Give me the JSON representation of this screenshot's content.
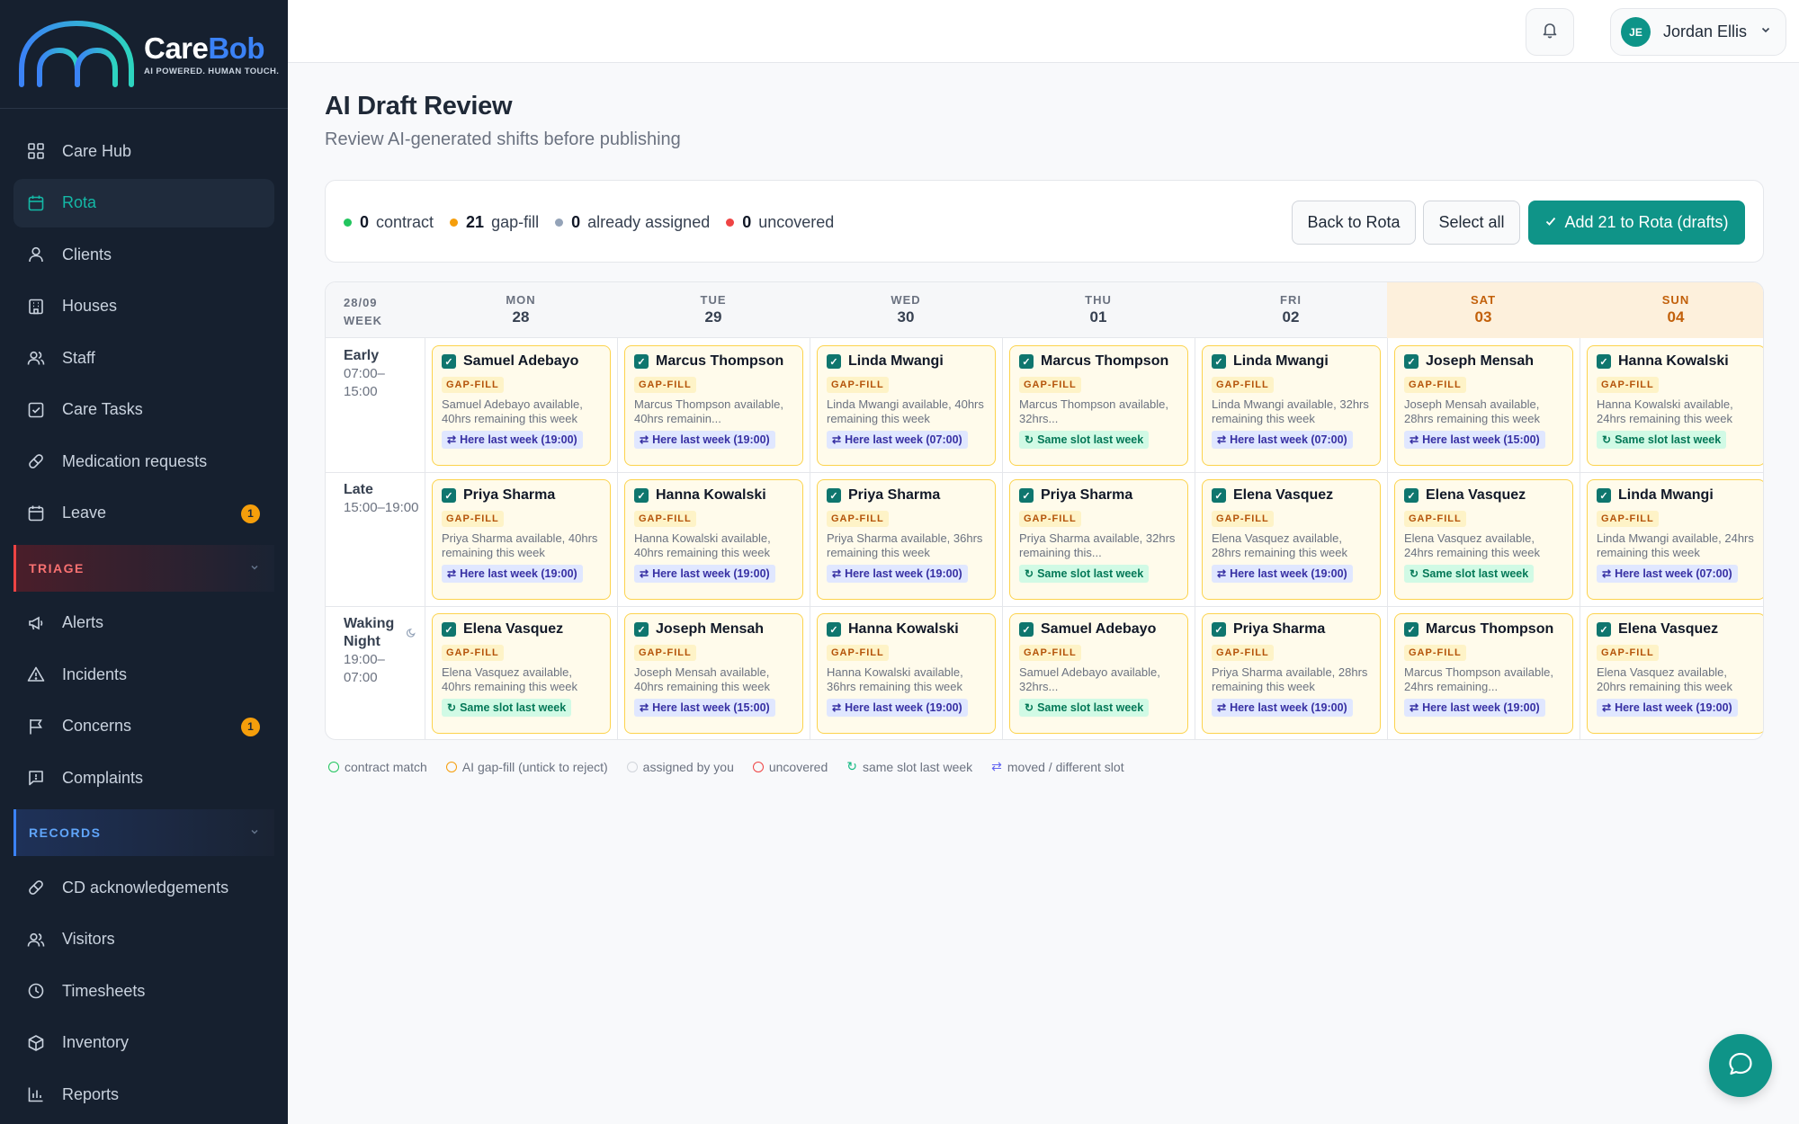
{
  "brand": {
    "name_part1": "Care",
    "name_part2": "Bob",
    "tagline": "AI POWERED. HUMAN TOUCH.",
    "accent": "#0f9488",
    "logo_blue": "#3b82f6"
  },
  "sidebar": {
    "items": [
      {
        "label": "Care Hub",
        "icon": "grid-icon"
      },
      {
        "label": "Rota",
        "icon": "calendar-icon",
        "active": true
      },
      {
        "label": "Clients",
        "icon": "user-icon"
      },
      {
        "label": "Houses",
        "icon": "building-icon"
      },
      {
        "label": "Staff",
        "icon": "users-icon"
      },
      {
        "label": "Care Tasks",
        "icon": "checkbox-icon"
      },
      {
        "label": "Medication requests",
        "icon": "pill-icon"
      },
      {
        "label": "Leave",
        "icon": "calendar-icon",
        "badge": "1"
      }
    ],
    "triage": {
      "label": "TRIAGE",
      "items": [
        {
          "label": "Alerts",
          "icon": "megaphone-icon"
        },
        {
          "label": "Incidents",
          "icon": "warning-icon"
        },
        {
          "label": "Concerns",
          "icon": "flag-icon",
          "badge": "1"
        },
        {
          "label": "Complaints",
          "icon": "message-icon"
        }
      ]
    },
    "records": {
      "label": "RECORDS",
      "items": [
        {
          "label": "CD acknowledgements",
          "icon": "pill-icon"
        },
        {
          "label": "Visitors",
          "icon": "users-icon"
        },
        {
          "label": "Timesheets",
          "icon": "clock-icon"
        },
        {
          "label": "Inventory",
          "icon": "box-icon"
        },
        {
          "label": "Reports",
          "icon": "chart-icon"
        }
      ]
    }
  },
  "topbar": {
    "user_initials": "JE",
    "user_name": "Jordan Ellis"
  },
  "page": {
    "title": "AI Draft Review",
    "subtitle": "Review AI-generated shifts before publishing"
  },
  "summary": {
    "stats": [
      {
        "count": "0",
        "label": "contract",
        "color": "#22c55e"
      },
      {
        "count": "21",
        "label": "gap-fill",
        "color": "#f59e0b"
      },
      {
        "count": "0",
        "label": "already assigned",
        "color": "#94a3b8"
      },
      {
        "count": "0",
        "label": "uncovered",
        "color": "#ef4444"
      }
    ],
    "back_label": "Back to Rota",
    "select_all_label": "Select all",
    "add_label": "Add 21 to Rota (drafts)"
  },
  "grid": {
    "week_label_1": "28/09",
    "week_label_2": "WEEK",
    "days": [
      {
        "name": "MON",
        "date": "28"
      },
      {
        "name": "TUE",
        "date": "29"
      },
      {
        "name": "WED",
        "date": "30"
      },
      {
        "name": "THU",
        "date": "01"
      },
      {
        "name": "FRI",
        "date": "02"
      },
      {
        "name": "SAT",
        "date": "03"
      },
      {
        "name": "SUN",
        "date": "04"
      }
    ],
    "rows": [
      {
        "name": "Early",
        "time1": "07:00–",
        "time2": "15:00",
        "cells": [
          {
            "name": "Samuel Adebayo",
            "tag": "GAP-FILL",
            "avail": "Samuel Adebayo available, 40hrs remaining this week",
            "pill": "Here last week (19:00)",
            "pill_type": "moved"
          },
          {
            "name": "Marcus Thompson",
            "tag": "GAP-FILL",
            "avail": "Marcus Thompson available, 40hrs remainin...",
            "pill": "Here last week (19:00)",
            "pill_type": "moved"
          },
          {
            "name": "Linda Mwangi",
            "tag": "GAP-FILL",
            "avail": "Linda Mwangi available, 40hrs remaining this week",
            "pill": "Here last week (07:00)",
            "pill_type": "moved"
          },
          {
            "name": "Marcus Thompson",
            "tag": "GAP-FILL",
            "avail": "Marcus Thompson available, 32hrs...",
            "pill": "Same slot last week",
            "pill_type": "same"
          },
          {
            "name": "Linda Mwangi",
            "tag": "GAP-FILL",
            "avail": "Linda Mwangi available, 32hrs remaining this week",
            "pill": "Here last week (07:00)",
            "pill_type": "moved"
          },
          {
            "name": "Joseph Mensah",
            "tag": "GAP-FILL",
            "avail": "Joseph Mensah available, 28hrs remaining this week",
            "pill": "Here last week (15:00)",
            "pill_type": "moved"
          },
          {
            "name": "Hanna Kowalski",
            "tag": "GAP-FILL",
            "avail": "Hanna Kowalski available, 24hrs remaining this week",
            "pill": "Same slot last week",
            "pill_type": "same"
          }
        ]
      },
      {
        "name": "Late",
        "time1": "15:00–19:00",
        "time2": "",
        "cells": [
          {
            "name": "Priya Sharma",
            "tag": "GAP-FILL",
            "avail": "Priya Sharma available, 40hrs remaining this week",
            "pill": "Here last week (19:00)",
            "pill_type": "moved"
          },
          {
            "name": "Hanna Kowalski",
            "tag": "GAP-FILL",
            "avail": "Hanna Kowalski available, 40hrs remaining this week",
            "pill": "Here last week (19:00)",
            "pill_type": "moved"
          },
          {
            "name": "Priya Sharma",
            "tag": "GAP-FILL",
            "avail": "Priya Sharma available, 36hrs remaining this week",
            "pill": "Here last week (19:00)",
            "pill_type": "moved"
          },
          {
            "name": "Priya Sharma",
            "tag": "GAP-FILL",
            "avail": "Priya Sharma available, 32hrs remaining this...",
            "pill": "Same slot last week",
            "pill_type": "same"
          },
          {
            "name": "Elena Vasquez",
            "tag": "GAP-FILL",
            "avail": "Elena Vasquez available, 28hrs remaining this week",
            "pill": "Here last week (19:00)",
            "pill_type": "moved"
          },
          {
            "name": "Elena Vasquez",
            "tag": "GAP-FILL",
            "avail": "Elena Vasquez available, 24hrs remaining this week",
            "pill": "Same slot last week",
            "pill_type": "same"
          },
          {
            "name": "Linda Mwangi",
            "tag": "GAP-FILL",
            "avail": "Linda Mwangi available, 24hrs remaining this week",
            "pill": "Here last week (07:00)",
            "pill_type": "moved"
          }
        ]
      },
      {
        "name": "Waking Night",
        "time1": "19:00–",
        "time2": "07:00",
        "cells": [
          {
            "name": "Elena Vasquez",
            "tag": "GAP-FILL",
            "avail": "Elena Vasquez available, 40hrs remaining this week",
            "pill": "Same slot last week",
            "pill_type": "same"
          },
          {
            "name": "Joseph Mensah",
            "tag": "GAP-FILL",
            "avail": "Joseph Mensah available, 40hrs remaining this week",
            "pill": "Here last week (15:00)",
            "pill_type": "moved"
          },
          {
            "name": "Hanna Kowalski",
            "tag": "GAP-FILL",
            "avail": "Hanna Kowalski available, 36hrs remaining this week",
            "pill": "Here last week (19:00)",
            "pill_type": "moved"
          },
          {
            "name": "Samuel Adebayo",
            "tag": "GAP-FILL",
            "avail": "Samuel Adebayo available, 32hrs...",
            "pill": "Same slot last week",
            "pill_type": "same"
          },
          {
            "name": "Priya Sharma",
            "tag": "GAP-FILL",
            "avail": "Priya Sharma available, 28hrs remaining this week",
            "pill": "Here last week (19:00)",
            "pill_type": "moved"
          },
          {
            "name": "Marcus Thompson",
            "tag": "GAP-FILL",
            "avail": "Marcus Thompson available, 24hrs remaining...",
            "pill": "Here last week (19:00)",
            "pill_type": "moved"
          },
          {
            "name": "Elena Vasquez",
            "tag": "GAP-FILL",
            "avail": "Elena Vasquez available, 20hrs remaining this week",
            "pill": "Here last week (19:00)",
            "pill_type": "moved"
          }
        ]
      }
    ]
  },
  "legend": [
    {
      "label": "contract match",
      "kind": "circle",
      "color": "#22c55e"
    },
    {
      "label": "AI gap-fill (untick to reject)",
      "kind": "circle",
      "color": "#f59e0b"
    },
    {
      "label": "assigned by you",
      "kind": "circle",
      "color": "#d1d5db"
    },
    {
      "label": "uncovered",
      "kind": "circle",
      "color": "#ef4444"
    },
    {
      "label": "same slot last week",
      "kind": "same"
    },
    {
      "label": "moved / different slot",
      "kind": "moved"
    }
  ]
}
